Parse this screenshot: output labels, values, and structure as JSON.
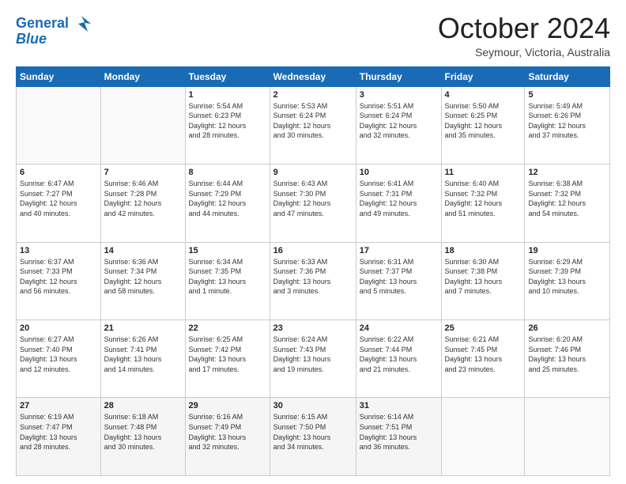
{
  "header": {
    "logo_line1": "General",
    "logo_line2": "Blue",
    "month": "October 2024",
    "location": "Seymour, Victoria, Australia"
  },
  "days_of_week": [
    "Sunday",
    "Monday",
    "Tuesday",
    "Wednesday",
    "Thursday",
    "Friday",
    "Saturday"
  ],
  "weeks": [
    [
      {
        "day": "",
        "info": ""
      },
      {
        "day": "",
        "info": ""
      },
      {
        "day": "1",
        "info": "Sunrise: 5:54 AM\nSunset: 6:23 PM\nDaylight: 12 hours\nand 28 minutes."
      },
      {
        "day": "2",
        "info": "Sunrise: 5:53 AM\nSunset: 6:24 PM\nDaylight: 12 hours\nand 30 minutes."
      },
      {
        "day": "3",
        "info": "Sunrise: 5:51 AM\nSunset: 6:24 PM\nDaylight: 12 hours\nand 32 minutes."
      },
      {
        "day": "4",
        "info": "Sunrise: 5:50 AM\nSunset: 6:25 PM\nDaylight: 12 hours\nand 35 minutes."
      },
      {
        "day": "5",
        "info": "Sunrise: 5:49 AM\nSunset: 6:26 PM\nDaylight: 12 hours\nand 37 minutes."
      }
    ],
    [
      {
        "day": "6",
        "info": "Sunrise: 6:47 AM\nSunset: 7:27 PM\nDaylight: 12 hours\nand 40 minutes."
      },
      {
        "day": "7",
        "info": "Sunrise: 6:46 AM\nSunset: 7:28 PM\nDaylight: 12 hours\nand 42 minutes."
      },
      {
        "day": "8",
        "info": "Sunrise: 6:44 AM\nSunset: 7:29 PM\nDaylight: 12 hours\nand 44 minutes."
      },
      {
        "day": "9",
        "info": "Sunrise: 6:43 AM\nSunset: 7:30 PM\nDaylight: 12 hours\nand 47 minutes."
      },
      {
        "day": "10",
        "info": "Sunrise: 6:41 AM\nSunset: 7:31 PM\nDaylight: 12 hours\nand 49 minutes."
      },
      {
        "day": "11",
        "info": "Sunrise: 6:40 AM\nSunset: 7:32 PM\nDaylight: 12 hours\nand 51 minutes."
      },
      {
        "day": "12",
        "info": "Sunrise: 6:38 AM\nSunset: 7:32 PM\nDaylight: 12 hours\nand 54 minutes."
      }
    ],
    [
      {
        "day": "13",
        "info": "Sunrise: 6:37 AM\nSunset: 7:33 PM\nDaylight: 12 hours\nand 56 minutes."
      },
      {
        "day": "14",
        "info": "Sunrise: 6:36 AM\nSunset: 7:34 PM\nDaylight: 12 hours\nand 58 minutes."
      },
      {
        "day": "15",
        "info": "Sunrise: 6:34 AM\nSunset: 7:35 PM\nDaylight: 13 hours\nand 1 minute."
      },
      {
        "day": "16",
        "info": "Sunrise: 6:33 AM\nSunset: 7:36 PM\nDaylight: 13 hours\nand 3 minutes."
      },
      {
        "day": "17",
        "info": "Sunrise: 6:31 AM\nSunset: 7:37 PM\nDaylight: 13 hours\nand 5 minutes."
      },
      {
        "day": "18",
        "info": "Sunrise: 6:30 AM\nSunset: 7:38 PM\nDaylight: 13 hours\nand 7 minutes."
      },
      {
        "day": "19",
        "info": "Sunrise: 6:29 AM\nSunset: 7:39 PM\nDaylight: 13 hours\nand 10 minutes."
      }
    ],
    [
      {
        "day": "20",
        "info": "Sunrise: 6:27 AM\nSunset: 7:40 PM\nDaylight: 13 hours\nand 12 minutes."
      },
      {
        "day": "21",
        "info": "Sunrise: 6:26 AM\nSunset: 7:41 PM\nDaylight: 13 hours\nand 14 minutes."
      },
      {
        "day": "22",
        "info": "Sunrise: 6:25 AM\nSunset: 7:42 PM\nDaylight: 13 hours\nand 17 minutes."
      },
      {
        "day": "23",
        "info": "Sunrise: 6:24 AM\nSunset: 7:43 PM\nDaylight: 13 hours\nand 19 minutes."
      },
      {
        "day": "24",
        "info": "Sunrise: 6:22 AM\nSunset: 7:44 PM\nDaylight: 13 hours\nand 21 minutes."
      },
      {
        "day": "25",
        "info": "Sunrise: 6:21 AM\nSunset: 7:45 PM\nDaylight: 13 hours\nand 23 minutes."
      },
      {
        "day": "26",
        "info": "Sunrise: 6:20 AM\nSunset: 7:46 PM\nDaylight: 13 hours\nand 25 minutes."
      }
    ],
    [
      {
        "day": "27",
        "info": "Sunrise: 6:19 AM\nSunset: 7:47 PM\nDaylight: 13 hours\nand 28 minutes."
      },
      {
        "day": "28",
        "info": "Sunrise: 6:18 AM\nSunset: 7:48 PM\nDaylight: 13 hours\nand 30 minutes."
      },
      {
        "day": "29",
        "info": "Sunrise: 6:16 AM\nSunset: 7:49 PM\nDaylight: 13 hours\nand 32 minutes."
      },
      {
        "day": "30",
        "info": "Sunrise: 6:15 AM\nSunset: 7:50 PM\nDaylight: 13 hours\nand 34 minutes."
      },
      {
        "day": "31",
        "info": "Sunrise: 6:14 AM\nSunset: 7:51 PM\nDaylight: 13 hours\nand 36 minutes."
      },
      {
        "day": "",
        "info": ""
      },
      {
        "day": "",
        "info": ""
      }
    ]
  ]
}
